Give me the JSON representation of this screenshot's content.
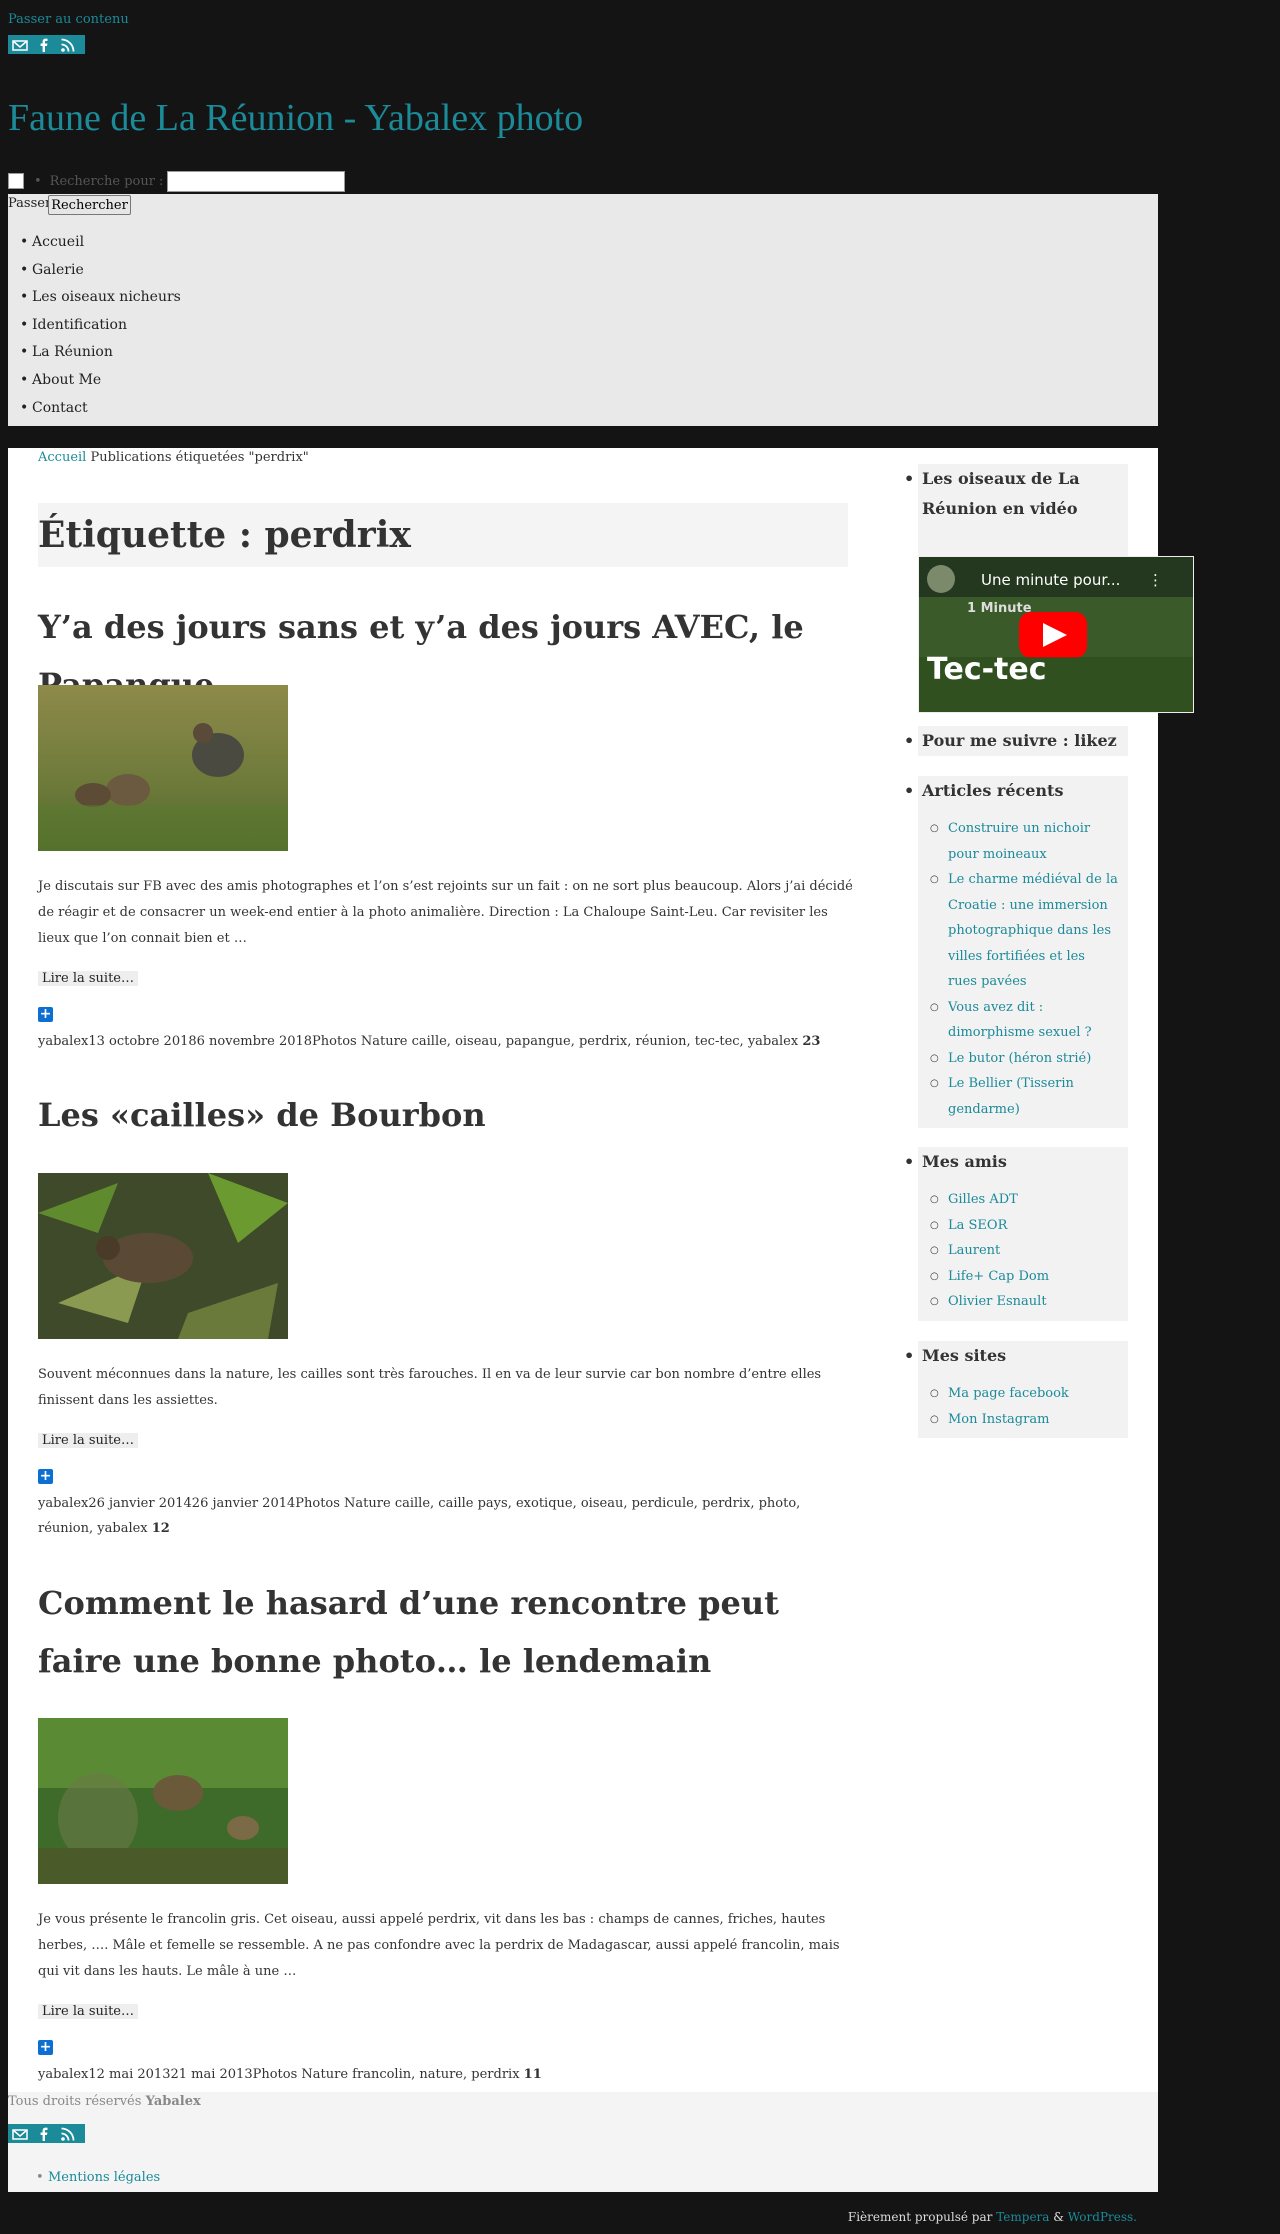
{
  "header": {
    "skip_link": "Passer au contenu",
    "site_title": "Faune de La Réunion - Yabalex photo",
    "search_label": "Recherche pour :",
    "search_button": "Rechercher",
    "skip_link2": "Passer au contenu"
  },
  "nav": {
    "items": [
      "Accueil",
      "Galerie",
      "Les oiseaux nicheurs",
      "Identification",
      "La Réunion",
      "About Me",
      "Contact"
    ]
  },
  "breadcrumb": {
    "home": "Accueil",
    "current": "Publications étiquetées \"perdrix\""
  },
  "tag_title": "Étiquette : perdrix",
  "posts": [
    {
      "title": "Y’a des jours sans et y’a des jours AVEC, le Papangue",
      "excerpt": "Je discutais sur FB avec des amis photographes et l’on s’est rejoints sur un fait : on ne sort plus beaucoup. Alors j’ai décidé de réagir et de consacrer un week-end entier à la photo animalière. Direction : La Chaloupe Saint-Leu. Car revisiter les lieux que l’on connait bien et …",
      "read_more": "Lire la suite…",
      "meta": "yabalex13 octobre 20186 novembre 2018Photos Nature caille, oiseau, papangue, perdrix, réunion, tec-tec, yabalex",
      "comments": "23"
    },
    {
      "title": "Les «cailles» de Bourbon",
      "excerpt": "Souvent méconnues dans la nature, les cailles sont très farouches. Il en va de leur survie car bon nombre d’entre elles finissent dans les assiettes.",
      "read_more": "Lire la suite…",
      "meta": "yabalex26 janvier 201426 janvier 2014Photos Nature caille, caille pays, exotique, oiseau, perdicule, perdrix, photo, réunion, yabalex",
      "comments": "12"
    },
    {
      "title": "Comment le hasard d’une rencontre peut faire une bonne photo… le lendemain",
      "excerpt": "Je vous présente le francolin gris. Cet oiseau, aussi appelé perdrix, vit dans les bas : champs de cannes, friches, hautes herbes, …. Mâle et femelle se ressemble. A ne pas confondre avec la perdrix de Madagascar, aussi appelé francolin, mais qui vit dans les hauts. Le mâle à une …",
      "read_more": "Lire la suite…",
      "meta": "yabalex12 mai 201321 mai 2013Photos Nature francolin, nature, perdrix",
      "comments": "11"
    }
  ],
  "sidebar": {
    "video_widget_title": "Les oiseaux de La Réunion en vidéo",
    "video_title": "Une minute pour...",
    "video_caption_small": "1 Minute",
    "video_caption": "Tec-tec",
    "follow_title": "Pour me suivre : likez",
    "recent_title": "Articles récents",
    "recent": [
      "Construire un nichoir pour moineaux",
      "Le charme médiéval de la Croatie : une immersion photographique dans les villes fortifiées et les rues pavées",
      "Vous avez dit : dimorphisme sexuel ?",
      "Le butor (héron strié)",
      "Le Bellier (Tisserin gendarme)"
    ],
    "friends_title": "Mes amis",
    "friends": [
      "Gilles ADT",
      "La SEOR",
      "Laurent",
      "Life+ Cap Dom",
      "Olivier Esnault"
    ],
    "sites_title": "Mes sites",
    "sites": [
      "Ma page facebook",
      "Mon Instagram"
    ]
  },
  "footer": {
    "copyright_prefix": "Tous droits réservés",
    "copyright_name": "Yabalex",
    "legal": "Mentions légales",
    "powered_prefix": "Fièrement propulsé par",
    "tempera": "Tempera",
    "and": "&",
    "wordpress": "WordPress."
  }
}
